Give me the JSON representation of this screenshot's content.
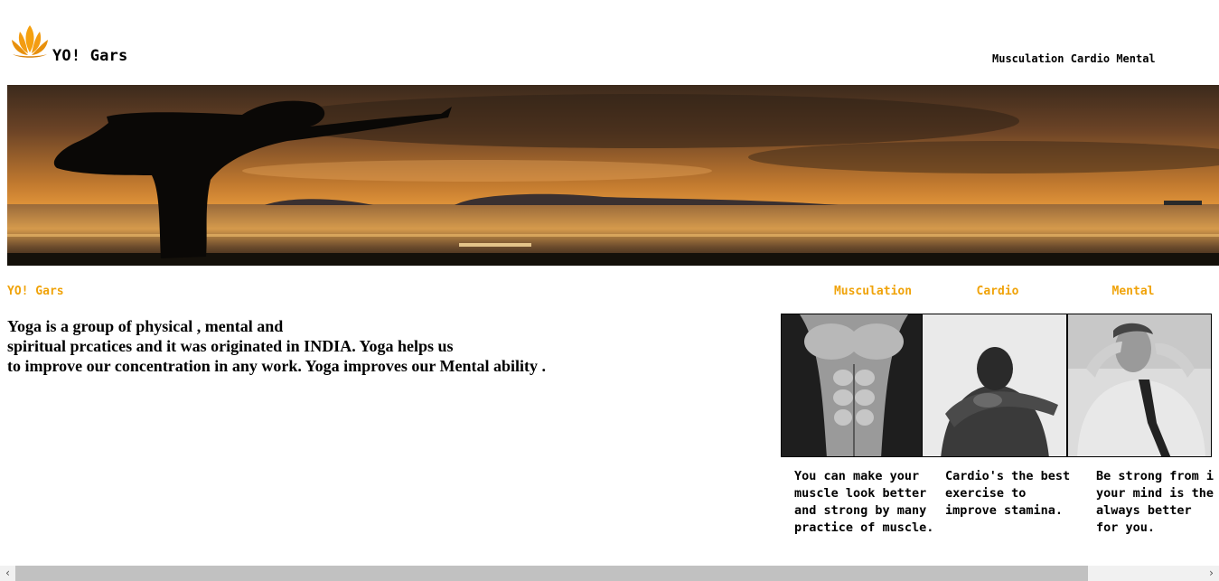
{
  "header": {
    "brand": "YO! Gars",
    "nav": [
      "Musculation",
      "Cardio",
      "Mental"
    ]
  },
  "section": {
    "title": "YO! Gars",
    "intro_lines": [
      "Yoga is a group of physical , mental and",
      "spiritual prcatices and it was originated in INDIA. Yoga helps us",
      "to improve our concentration in any work. Yoga improves our Mental ability ."
    ]
  },
  "cards": [
    {
      "heading": "Musculation",
      "text_lines": [
        "You can make your",
        "muscle look better",
        "and strong by many",
        "practice of muscle."
      ]
    },
    {
      "heading": "Cardio",
      "text_lines": [
        "Cardio's the best",
        "exercise to",
        "improve stamina."
      ]
    },
    {
      "heading": "Mental",
      "text_lines": [
        "Be strong from i",
        "your mind is the",
        "always better",
        "for you."
      ]
    }
  ],
  "colors": {
    "accent": "#f0a30a",
    "text": "#000000"
  },
  "icons": {
    "logo": "lotus-icon",
    "scroll_left": "chevron-left-icon",
    "scroll_right": "chevron-right-icon"
  }
}
